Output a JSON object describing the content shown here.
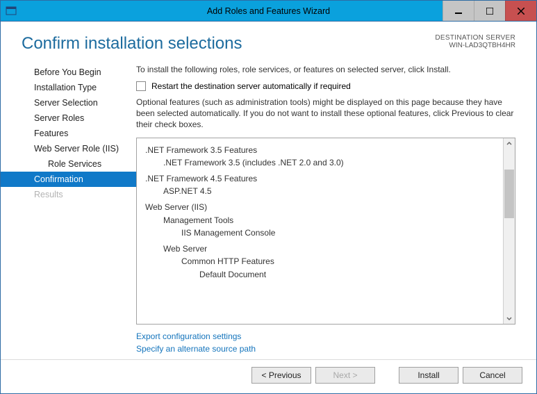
{
  "window": {
    "title": "Add Roles and Features Wizard"
  },
  "header": {
    "page_title": "Confirm installation selections",
    "dest_label": "DESTINATION SERVER",
    "dest_value": "WIN-LAD3QTBH4HR"
  },
  "sidebar": {
    "before_you_begin": "Before You Begin",
    "installation_type": "Installation Type",
    "server_selection": "Server Selection",
    "server_roles": "Server Roles",
    "features": "Features",
    "web_server_role": "Web Server Role (IIS)",
    "role_services": "Role Services",
    "confirmation": "Confirmation",
    "results": "Results"
  },
  "main": {
    "instruction": "To install the following roles, role services, or features on selected server, click Install.",
    "restart_checkbox_label": "Restart the destination server automatically if required",
    "note": "Optional features (such as administration tools) might be displayed on this page because they have been selected automatically. If you do not want to install these optional features, click Previous to clear their check boxes.",
    "tree": {
      "net35_group": ".NET Framework 3.5 Features",
      "net35_item": ".NET Framework 3.5 (includes .NET 2.0 and 3.0)",
      "net45_group": ".NET Framework 4.5 Features",
      "aspnet45": "ASP.NET 4.5",
      "web_server_iis": "Web Server (IIS)",
      "mgmt_tools": "Management Tools",
      "iis_console": "IIS Management Console",
      "web_server": "Web Server",
      "common_http": "Common HTTP Features",
      "default_doc": "Default Document"
    },
    "links": {
      "export": "Export configuration settings",
      "alt_source": "Specify an alternate source path"
    }
  },
  "footer": {
    "previous": "< Previous",
    "next": "Next >",
    "install": "Install",
    "cancel": "Cancel"
  }
}
